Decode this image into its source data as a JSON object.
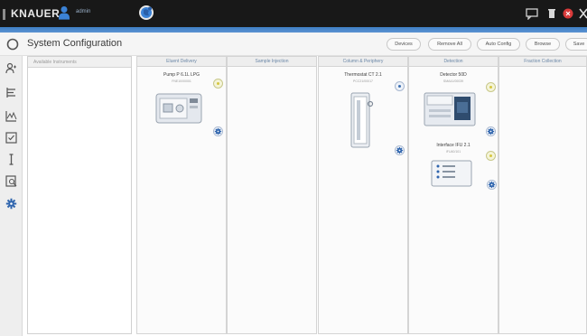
{
  "topbar": {
    "brand": "KNAUER",
    "user_name": "admin",
    "icons": [
      "user-icon",
      "globe-icon",
      "chat-icon",
      "trash-icon",
      "error-icon",
      "close-icon"
    ]
  },
  "header": {
    "title": "System Configuration",
    "buttons": {
      "devices": "Devices",
      "remove_all": "Remove All",
      "auto_config": "Auto Config",
      "browse": "Browse",
      "save": "Save"
    }
  },
  "nav": [
    "back-icon",
    "instruments-icon",
    "method-icon",
    "chart-icon",
    "checklist-icon",
    "text-cursor-icon",
    "report-icon",
    "settings-icon"
  ],
  "available": {
    "label": "Available Instruments"
  },
  "columns": [
    {
      "title": "Eluent Delivery",
      "instruments": [
        {
          "name": "Pump P 6.1L LPG",
          "serial": "FNE10/00001"
        }
      ]
    },
    {
      "title": "Sample Injection",
      "instruments": []
    },
    {
      "title": "Column & Periphery",
      "instruments": [
        {
          "name": "Thermostat CT 2.1",
          "serial": "PCC21/00017"
        }
      ]
    },
    {
      "title": "Detection",
      "instruments": [
        {
          "name": "Detector 50D",
          "serial": "SMA41/00039"
        },
        {
          "name": "Interface IFU 2.1",
          "serial": "IFU40/101"
        }
      ]
    },
    {
      "title": "Fraction Collection",
      "instruments": []
    }
  ],
  "colors": {
    "topbar": "#181818",
    "accent": "#3d7ec4",
    "column_header_text": "#6a86a6"
  }
}
